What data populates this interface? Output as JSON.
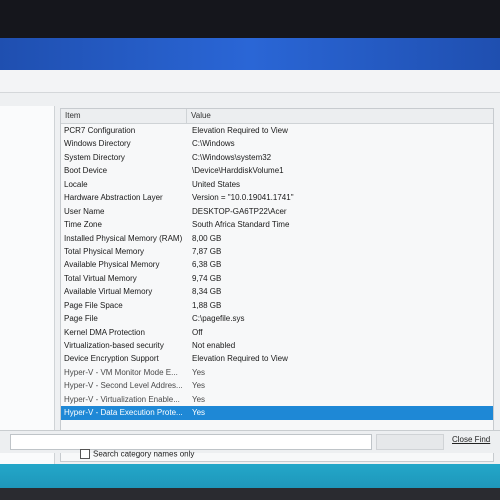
{
  "list": {
    "header": {
      "item": "Item",
      "value": "Value"
    },
    "rows": [
      {
        "item": "PCR7 Configuration",
        "value": "Elevation Required to View"
      },
      {
        "item": "Windows Directory",
        "value": "C:\\Windows"
      },
      {
        "item": "System Directory",
        "value": "C:\\Windows\\system32"
      },
      {
        "item": "Boot Device",
        "value": "\\Device\\HarddiskVolume1"
      },
      {
        "item": "Locale",
        "value": "United States"
      },
      {
        "item": "Hardware Abstraction Layer",
        "value": "Version = \"10.0.19041.1741\""
      },
      {
        "item": "User Name",
        "value": "DESKTOP-GA6TP22\\Acer"
      },
      {
        "item": "Time Zone",
        "value": "South Africa Standard Time"
      },
      {
        "item": "Installed Physical Memory (RAM)",
        "value": "8,00 GB"
      },
      {
        "item": "Total Physical Memory",
        "value": "7,87 GB"
      },
      {
        "item": "Available Physical Memory",
        "value": "6,38 GB"
      },
      {
        "item": "Total Virtual Memory",
        "value": "9,74 GB"
      },
      {
        "item": "Available Virtual Memory",
        "value": "8,34 GB"
      },
      {
        "item": "Page File Space",
        "value": "1,88 GB"
      },
      {
        "item": "Page File",
        "value": "C:\\pagefile.sys"
      },
      {
        "item": "Kernel DMA Protection",
        "value": "Off"
      },
      {
        "item": "Virtualization-based security",
        "value": "Not enabled"
      },
      {
        "item": "Device Encryption Support",
        "value": "Elevation Required to View"
      },
      {
        "item": "Hyper-V - VM Monitor Mode E...",
        "value": "Yes"
      },
      {
        "item": "Hyper-V - Second Level Addres...",
        "value": "Yes"
      },
      {
        "item": "Hyper-V - Virtualization Enable...",
        "value": "Yes"
      },
      {
        "item": "Hyper-V - Data Execution Prote...",
        "value": "Yes"
      }
    ]
  },
  "find": {
    "close_label": "Close Find",
    "search_category_label": "Search category names only"
  },
  "colors": {
    "selection": "#1e88d6",
    "taskbar": "#23a7c9",
    "wallpaper": "#2a66d6"
  }
}
